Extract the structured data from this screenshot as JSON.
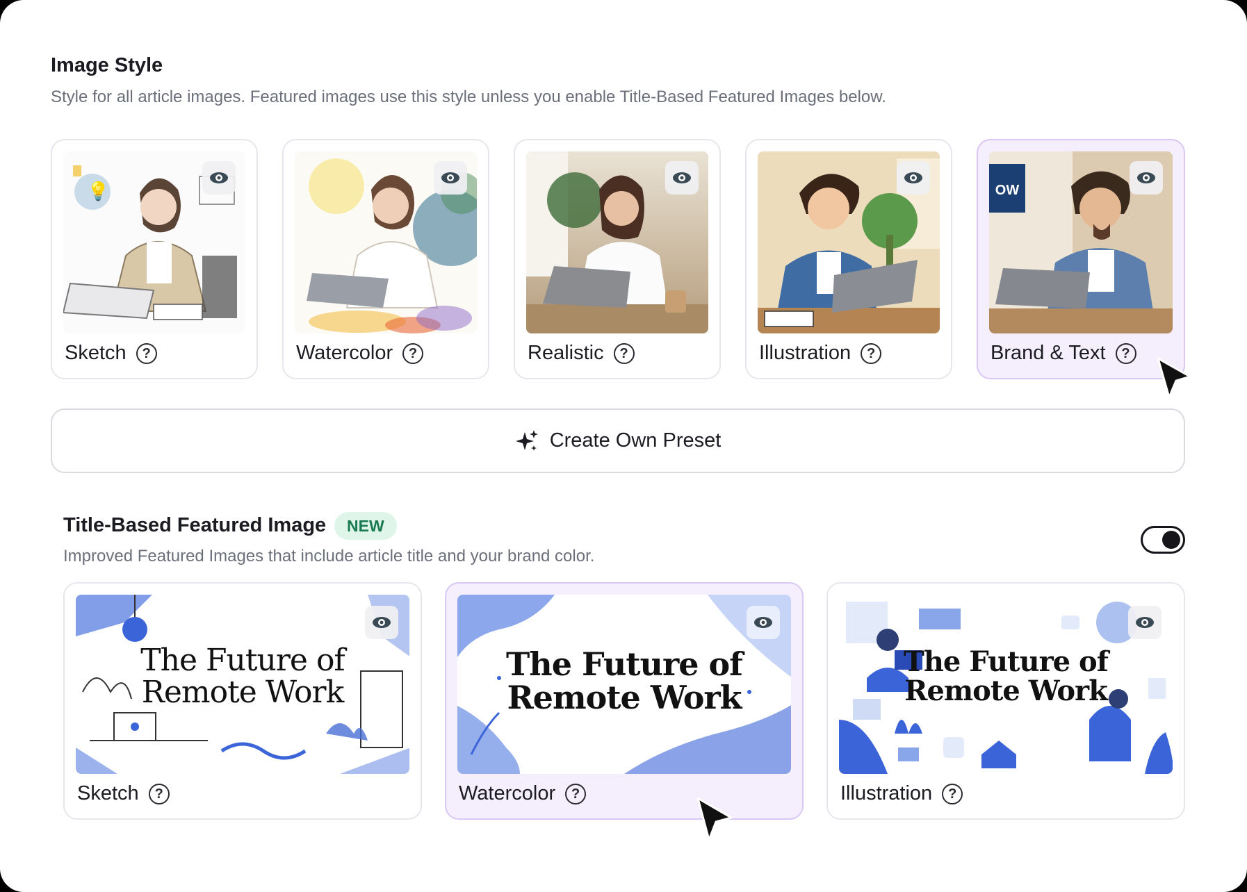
{
  "image_style": {
    "title": "Image Style",
    "description": "Style for all article images. Featured images use this style unless you enable Title-Based Featured Images below.",
    "cards": [
      {
        "label": "Sketch",
        "selected": false
      },
      {
        "label": "Watercolor",
        "selected": false
      },
      {
        "label": "Realistic",
        "selected": false
      },
      {
        "label": "Illustration",
        "selected": false
      },
      {
        "label": "Brand & Text",
        "selected": true,
        "thumb_text": "OW"
      }
    ],
    "help_glyph": "?",
    "preset_label": "Create Own Preset",
    "preset_icon": "sparkles-icon"
  },
  "title_based": {
    "title": "Title-Based Featured Image",
    "badge": "NEW",
    "description": "Improved Featured Images that include article title and your brand color.",
    "toggle_on": true,
    "cards": [
      {
        "label": "Sketch",
        "selected": false,
        "title_line1": "The Future of",
        "title_line2": "Remote Work"
      },
      {
        "label": "Watercolor",
        "selected": true,
        "title_line1": "The Future of",
        "title_line2": "Remote Work"
      },
      {
        "label": "Illustration",
        "selected": false,
        "title_line1": "The Future of",
        "title_line2": "Remote Work"
      }
    ]
  },
  "colors": {
    "selected_bg": "#f5effd",
    "selected_border": "#d9c7f5",
    "badge_bg": "#dff5ea",
    "badge_text": "#1a7a4f",
    "accent_blue": "#3a64d8"
  }
}
